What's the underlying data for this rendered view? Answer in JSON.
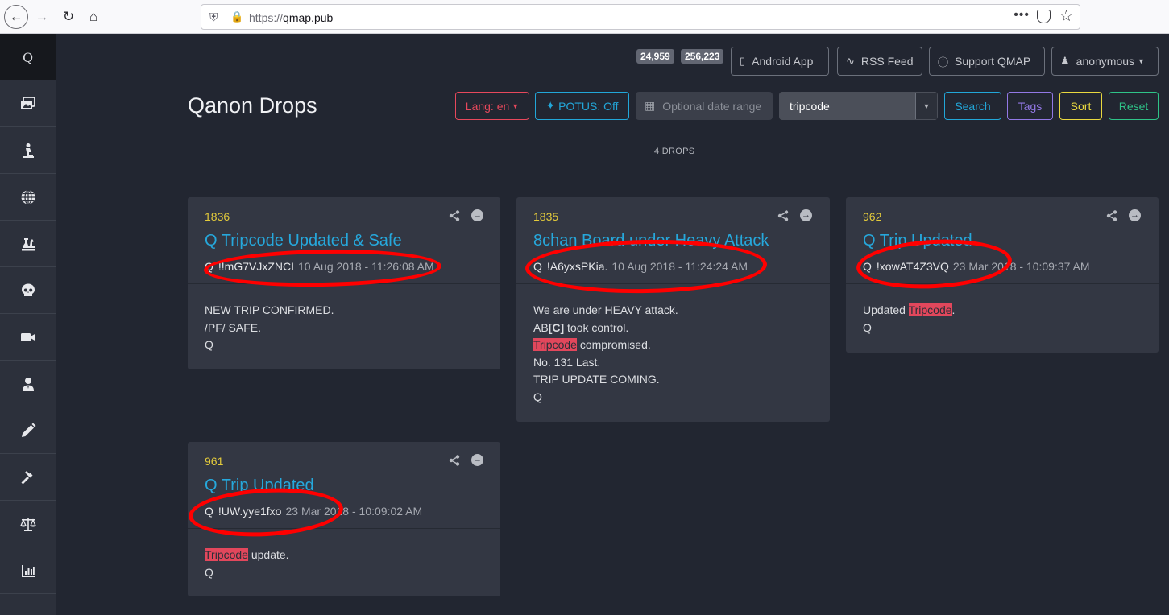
{
  "browser": {
    "url_prefix": "https://",
    "url_host": "qmap.pub"
  },
  "sidebar": {
    "logo": "Q",
    "items": [
      {
        "icon": "images-icon"
      },
      {
        "icon": "praying-person-icon"
      },
      {
        "icon": "globe-icon"
      },
      {
        "icon": "chess-icon"
      },
      {
        "icon": "skull-icon"
      },
      {
        "icon": "video-camera-icon"
      },
      {
        "icon": "user-secret-icon"
      },
      {
        "icon": "pencil-icon"
      },
      {
        "icon": "gavel-icon"
      },
      {
        "icon": "balance-scale-icon"
      },
      {
        "icon": "chart-bar-icon"
      }
    ]
  },
  "header": {
    "counter_1": "24,959",
    "counter_2": "256,223",
    "android_app": "Android App",
    "rss_feed": "RSS Feed",
    "support": "Support QMAP",
    "user": "anonymous"
  },
  "toolbar": {
    "title": "Qanon Drops",
    "lang": "Lang: en",
    "potus": "POTUS: Off",
    "date_placeholder": "Optional date range",
    "trip_value": "tripcode",
    "search": "Search",
    "tags": "Tags",
    "sort": "Sort",
    "reset": "Reset",
    "drops_count": "4 DROPS"
  },
  "colors": {
    "accent_blue": "#26a8dc",
    "number_yellow": "#e4cb3b",
    "highlight_red": "#e2475c",
    "annotation_red": "#ff0000"
  },
  "cards": [
    {
      "number": "1836",
      "title": "Q Tripcode Updated & Safe",
      "author": "Q",
      "trip": "!!mG7VJxZNCI",
      "date": "10 Aug 2018 - 11:26:08 AM",
      "lines": [
        {
          "pre": "NEW TRIP CONFIRMED.",
          "hl": "",
          "post": ""
        },
        {
          "pre": "/PF/ SAFE.",
          "hl": "",
          "post": ""
        },
        {
          "pre": "Q",
          "hl": "",
          "post": ""
        }
      ]
    },
    {
      "number": "1835",
      "title": "8chan Board under Heavy Attack",
      "author": "Q",
      "trip": "!A6yxsPKia.",
      "date": "10 Aug 2018 - 11:24:24 AM",
      "lines": [
        {
          "pre": "We are under HEAVY attack.",
          "hl": "",
          "post": ""
        },
        {
          "pre": "AB",
          "hl": "",
          "post": "[C] took control."
        },
        {
          "pre": "",
          "hl": "Tripcode",
          "post": " compromised."
        },
        {
          "pre": "No. 131 Last.",
          "hl": "",
          "post": ""
        },
        {
          "pre": "TRIP UPDATE COMING.",
          "hl": "",
          "post": ""
        },
        {
          "pre": "Q",
          "hl": "",
          "post": ""
        }
      ]
    },
    {
      "number": "962",
      "title": "Q Trip Updated",
      "author": "Q",
      "trip": "!xowAT4Z3VQ",
      "date": "23 Mar 2018 - 10:09:37 AM",
      "lines": [
        {
          "pre": "Updated ",
          "hl": "Tripcode",
          "post": "."
        },
        {
          "pre": "Q",
          "hl": "",
          "post": ""
        }
      ]
    },
    {
      "number": "961",
      "title": "Q Trip Updated",
      "author": "Q",
      "trip": "!UW.yye1fxo",
      "date": "23 Mar 2018 - 10:09:02 AM",
      "lines": [
        {
          "pre": "",
          "hl": "Tripcode",
          "post": " update."
        },
        {
          "pre": "Q",
          "hl": "",
          "post": ""
        }
      ]
    }
  ]
}
